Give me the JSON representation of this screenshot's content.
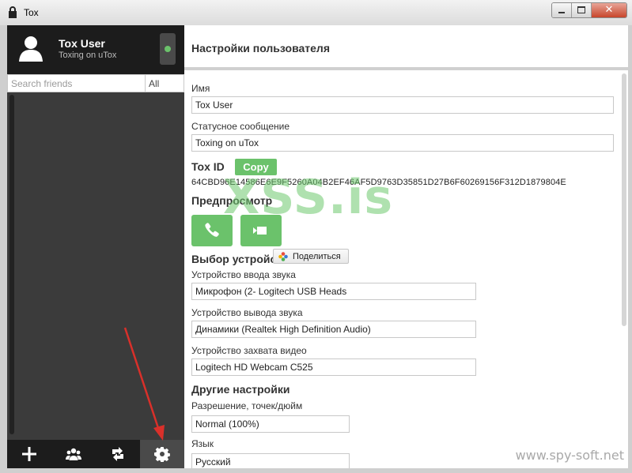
{
  "window": {
    "title": "Tox",
    "close_glyph": "✕"
  },
  "profile": {
    "name": "Tox User",
    "status_message": "Toxing on uTox",
    "status_color": "#6bc26b"
  },
  "search": {
    "placeholder": "Search friends",
    "filter_label": "All"
  },
  "bottom_bar": {
    "icons": [
      "add-friend-icon",
      "create-group-icon",
      "file-transfer-icon",
      "settings-gear-icon"
    ]
  },
  "settings": {
    "title": "Настройки пользователя",
    "name_label": "Имя",
    "name_value": "Tox User",
    "status_label": "Статусное сообщение",
    "status_value": "Toxing on uTox",
    "toxid_label": "Tox ID",
    "copy_label": "Copy",
    "toxid_value": "64CBD96E14586E6E9F5260A04B2EF46AF5D9763D35851D27B6F60269156F312D1879804E",
    "preview_label": "Предпросмотр",
    "devices_label": "Выбор устройств",
    "audio_in_label": "Устройство ввода звука",
    "audio_in_value": "Микрофон (2- Logitech USB Heads",
    "audio_out_label": "Устройство вывода звука",
    "audio_out_value": "Динамики (Realtek High Definition Audio)",
    "video_label": "Устройство захвата видео",
    "video_value": "Logitech HD Webcam C525",
    "other_label": "Другие настройки",
    "dpi_label": "Разрешение, точек/дюйм",
    "dpi_value": "Normal (100%)",
    "lang_label": "Язык",
    "lang_value": "Русский"
  },
  "share_button": {
    "label": "Поделиться"
  },
  "overlays": {
    "watermark": "XSS.is",
    "credit": "www.spy-soft.net"
  },
  "colors": {
    "accent": "#6bc26b",
    "sidebar_dark": "#1c1c1c",
    "sidebar": "#3b3b3b",
    "annotation_arrow": "#d9302a"
  }
}
